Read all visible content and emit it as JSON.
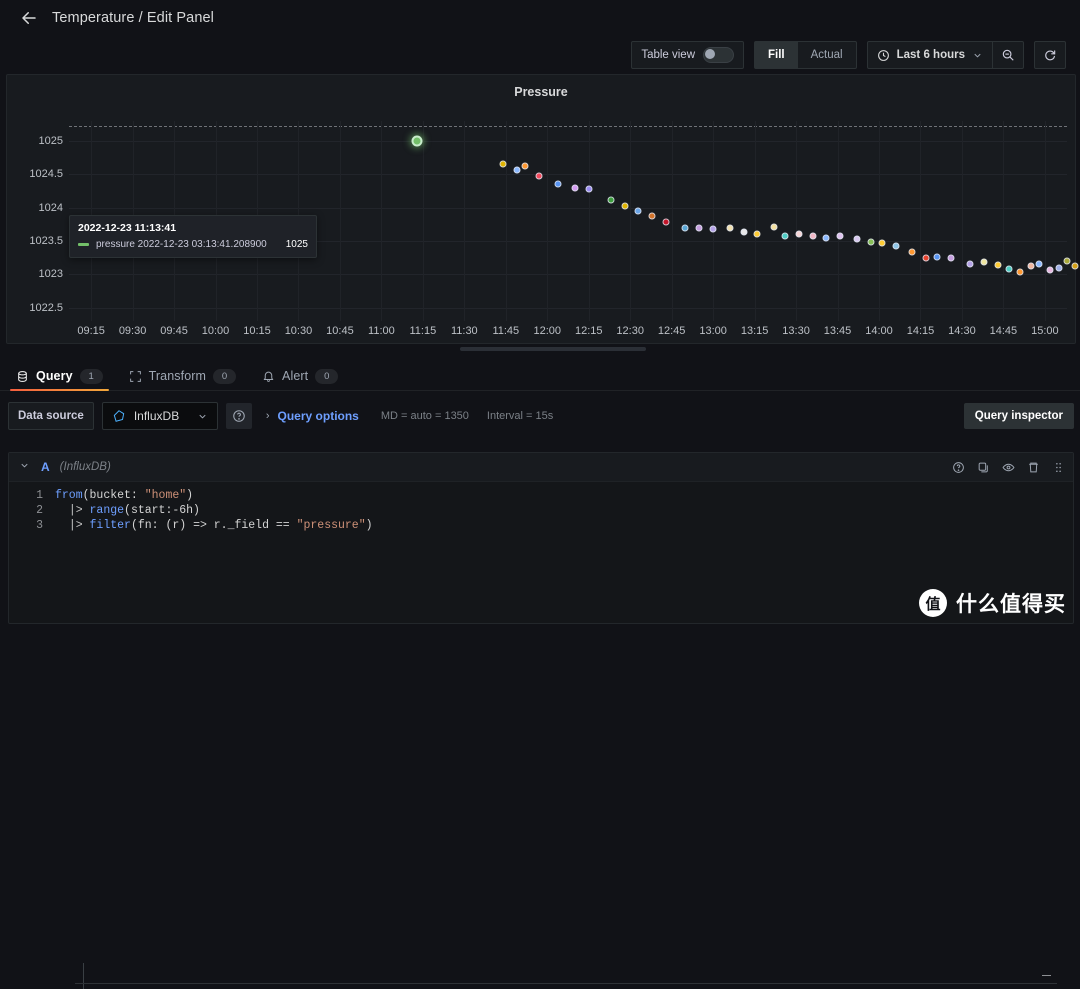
{
  "header": {
    "back_icon": "arrow-left-icon",
    "title": "Temperature / Edit Panel"
  },
  "toolbar": {
    "table_view_label": "Table view",
    "table_view_state": "off",
    "fill_label": "Fill",
    "actual_label": "Actual",
    "fill_active": true,
    "time_range": "Last 6 hours",
    "clock_icon": "clock-icon",
    "chevron_icon": "chevron-down-icon",
    "zoom_out_icon": "zoom-out-icon",
    "refresh_icon": "refresh-icon"
  },
  "panel": {
    "title": "Pressure",
    "tooltip": {
      "time": "2022-12-23 11:13:41",
      "series": "pressure 2022-12-23 03:13:41.208900",
      "value": "1025",
      "color": "#73bf69"
    }
  },
  "tabs": [
    {
      "label": "Query",
      "count": "1",
      "icon": "database-icon",
      "active": true
    },
    {
      "label": "Transform",
      "count": "0",
      "icon": "transform-icon",
      "active": false
    },
    {
      "label": "Alert",
      "count": "0",
      "icon": "bell-icon",
      "active": false
    }
  ],
  "query_bar": {
    "data_source_label": "Data source",
    "data_source_value": "InfluxDB",
    "data_source_icon": "influxdb-icon",
    "help_icon": "help-circle-icon",
    "query_options_label": "Query options",
    "max_data_points": "MD = auto = 1350",
    "interval": "Interval = 15s",
    "query_inspector_label": "Query inspector"
  },
  "query_editor": {
    "ref_id": "A",
    "data_source": "(InfluxDB)",
    "collapse_icon": "chevron-down-icon",
    "actions": [
      "help-circle-icon",
      "duplicate-icon",
      "eye-icon",
      "trash-icon",
      "drag-handle-icon"
    ],
    "code_lines": [
      {
        "num": "1",
        "text": "from(bucket: \"home\")"
      },
      {
        "num": "2",
        "text": "  |> range(start:-6h)"
      },
      {
        "num": "3",
        "text": "  |> filter(fn: (r) => r._field == \"pressure\")"
      }
    ]
  },
  "watermark": {
    "logo_char": "值",
    "text": "什么值得买"
  },
  "chart_data": {
    "type": "scatter",
    "title": "Pressure",
    "xlabel": "",
    "ylabel": "",
    "grid": true,
    "legend": "none",
    "ylim": [
      1022.3,
      1025.3
    ],
    "yticks": [
      1025,
      1024.5,
      1024,
      1023.5,
      1023,
      1022.5
    ],
    "xticks": [
      "09:15",
      "09:30",
      "09:45",
      "10:00",
      "10:15",
      "10:30",
      "10:45",
      "11:00",
      "11:15",
      "11:30",
      "11:45",
      "12:00",
      "12:15",
      "12:30",
      "12:45",
      "13:00",
      "13:15",
      "13:30",
      "13:45",
      "14:00",
      "14:15",
      "14:30",
      "14:45",
      "15:00"
    ],
    "threshold_line": 1025.15,
    "points": [
      {
        "x": "11:13",
        "y": 1025.0,
        "color": "#73bf69",
        "highlighted": true
      },
      {
        "x": "11:44",
        "y": 1024.65,
        "color": "#e0b400"
      },
      {
        "x": "11:49",
        "y": 1024.57,
        "color": "#8ab8ff"
      },
      {
        "x": "11:52",
        "y": 1024.62,
        "color": "#ff9830"
      },
      {
        "x": "11:57",
        "y": 1024.47,
        "color": "#f2495c"
      },
      {
        "x": "12:04",
        "y": 1024.35,
        "color": "#5794f2"
      },
      {
        "x": "12:10",
        "y": 1024.3,
        "color": "#d59cf2"
      },
      {
        "x": "12:15",
        "y": 1024.28,
        "color": "#9a8cf2"
      },
      {
        "x": "12:23",
        "y": 1024.12,
        "color": "#3d9e3d"
      },
      {
        "x": "12:28",
        "y": 1024.03,
        "color": "#e0b400"
      },
      {
        "x": "12:33",
        "y": 1023.95,
        "color": "#6aa5e8"
      },
      {
        "x": "12:38",
        "y": 1023.88,
        "color": "#d4742a"
      },
      {
        "x": "12:43",
        "y": 1023.79,
        "color": "#c4162a"
      },
      {
        "x": "12:50",
        "y": 1023.7,
        "color": "#5aa7d6"
      },
      {
        "x": "12:55",
        "y": 1023.69,
        "color": "#c79fe0"
      },
      {
        "x": "13:00",
        "y": 1023.68,
        "color": "#b6a3e8"
      },
      {
        "x": "13:06",
        "y": 1023.7,
        "color": "#f2e1b0"
      },
      {
        "x": "13:11",
        "y": 1023.63,
        "color": "#e8e8e8"
      },
      {
        "x": "13:16",
        "y": 1023.6,
        "color": "#ffcc33"
      },
      {
        "x": "13:22",
        "y": 1023.71,
        "color": "#f5e1a0"
      },
      {
        "x": "13:26",
        "y": 1023.58,
        "color": "#4ecdc4"
      },
      {
        "x": "13:31",
        "y": 1023.6,
        "color": "#f7d6d6"
      },
      {
        "x": "13:36",
        "y": 1023.58,
        "color": "#f2b8c6"
      },
      {
        "x": "13:41",
        "y": 1023.55,
        "color": "#8ab8ff"
      },
      {
        "x": "13:46",
        "y": 1023.58,
        "color": "#e0c2f0"
      },
      {
        "x": "13:52",
        "y": 1023.53,
        "color": "#d8c8f0"
      },
      {
        "x": "13:57",
        "y": 1023.49,
        "color": "#88c057"
      },
      {
        "x": "14:01",
        "y": 1023.47,
        "color": "#ffcc33"
      },
      {
        "x": "14:06",
        "y": 1023.42,
        "color": "#8fc7e8"
      },
      {
        "x": "14:12",
        "y": 1023.33,
        "color": "#ff9830"
      },
      {
        "x": "14:17",
        "y": 1023.25,
        "color": "#e8442f"
      },
      {
        "x": "14:21",
        "y": 1023.26,
        "color": "#5794f2"
      },
      {
        "x": "14:26",
        "y": 1023.24,
        "color": "#c79fe0"
      },
      {
        "x": "14:33",
        "y": 1023.16,
        "color": "#b6a3e8"
      },
      {
        "x": "14:38",
        "y": 1023.18,
        "color": "#f0e6a0"
      },
      {
        "x": "14:43",
        "y": 1023.14,
        "color": "#ffcc33"
      },
      {
        "x": "14:47",
        "y": 1023.08,
        "color": "#4ecdc4"
      },
      {
        "x": "14:51",
        "y": 1023.04,
        "color": "#ff9830"
      },
      {
        "x": "14:55",
        "y": 1023.12,
        "color": "#f2b8a0"
      },
      {
        "x": "14:58",
        "y": 1023.15,
        "color": "#8ab8ff"
      },
      {
        "x": "15:02",
        "y": 1023.06,
        "color": "#e8b8e0"
      },
      {
        "x": "15:05",
        "y": 1023.1,
        "color": "#a0b0e8"
      },
      {
        "x": "15:08",
        "y": 1023.2,
        "color": "#a8a83a"
      },
      {
        "x": "15:11",
        "y": 1023.13,
        "color": "#d4a017"
      }
    ]
  }
}
